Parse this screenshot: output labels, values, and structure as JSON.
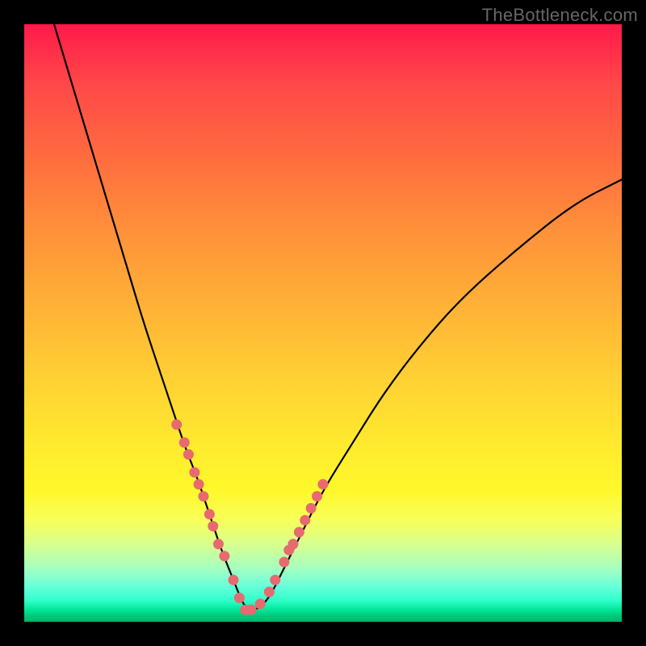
{
  "watermark": "TheBottleneck.com",
  "colors": {
    "background_frame": "#000000",
    "curve_stroke": "#000000",
    "marker_fill": "#e66a6f",
    "gradient_top": "#ff1a4a",
    "gradient_bottom": "#00b46a"
  },
  "chart_data": {
    "type": "line",
    "title": "",
    "xlabel": "",
    "ylabel": "",
    "xlim": [
      0,
      100
    ],
    "ylim": [
      0,
      100
    ],
    "grid": false,
    "legend": false,
    "annotations": [
      "TheBottleneck.com"
    ],
    "description": "Single V-shaped bottleneck curve on a rainbow gradient background; minimum near x≈37 y≈2. Salmon-colored markers cluster near the bottom of both arms of the V.",
    "series": [
      {
        "name": "curve",
        "x": [
          5,
          8,
          11,
          14,
          17,
          20,
          23,
          25,
          27,
          29,
          31,
          33,
          35,
          37,
          39,
          41,
          43,
          46,
          50,
          55,
          60,
          66,
          73,
          82,
          92,
          100
        ],
        "y": [
          100,
          90,
          80,
          70,
          60,
          50,
          41,
          35,
          29,
          24,
          18,
          12,
          7,
          2,
          2,
          4,
          8,
          14,
          22,
          30,
          38,
          46,
          54,
          62,
          70,
          74
        ]
      },
      {
        "name": "markers",
        "x": [
          25.5,
          26.8,
          27.5,
          28.5,
          29.2,
          30.0,
          31.0,
          31.6,
          32.5,
          33.5,
          35.0,
          36.0,
          37.0,
          38.0,
          39.5,
          41.0,
          42.0,
          43.5,
          44.3,
          45.0,
          46.0,
          47.0,
          48.0,
          49.0,
          50.0
        ],
        "y": [
          33,
          30,
          28,
          25,
          23,
          21,
          18,
          16,
          13,
          11,
          7,
          4,
          2,
          2,
          3,
          5,
          7,
          10,
          12,
          13,
          15,
          17,
          19,
          21,
          23
        ]
      }
    ]
  }
}
